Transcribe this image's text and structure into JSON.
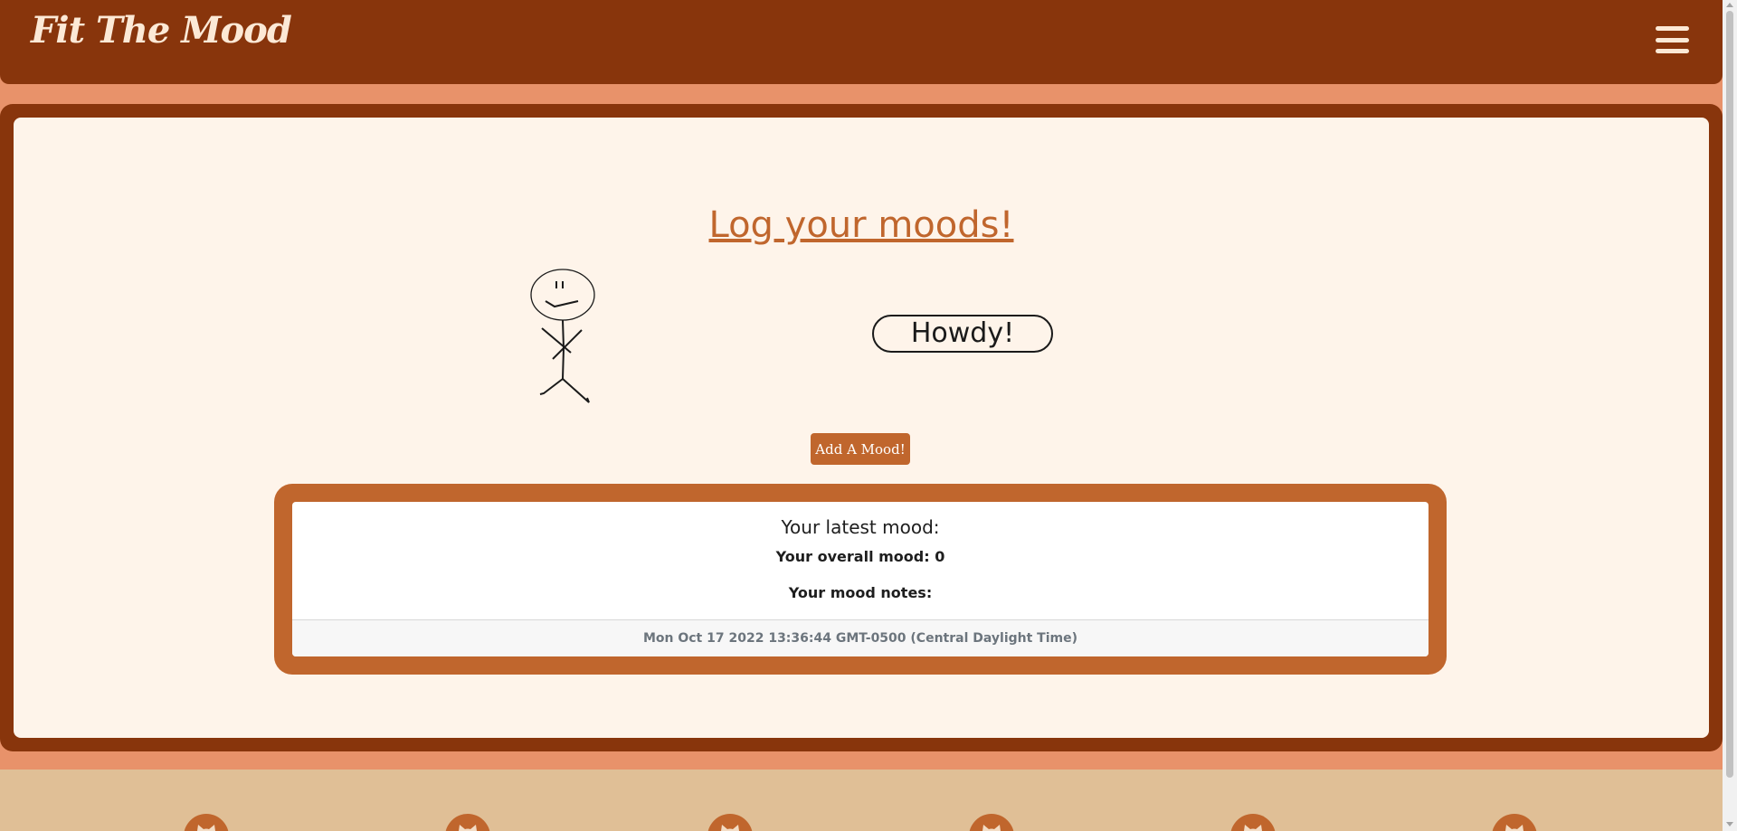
{
  "app": {
    "brand": "Fit The Mood",
    "menu_icon": "hamburger-menu-icon",
    "colors": {
      "header": "#88350C",
      "accent": "#C0662D",
      "panel": "#FEF4EA",
      "page": "#E8926A",
      "footer": "#E0BF96"
    }
  },
  "main": {
    "title": "Log your moods!",
    "speech": "Howdy!",
    "add_button": "Add A Mood!"
  },
  "mood_card": {
    "title": "Your latest mood:",
    "overall_label": "Your overall mood:",
    "overall_value": "0",
    "notes_label": "Your mood notes:",
    "timestamp": "Mon Oct 17 2022 13:36:44 GMT-0500 (Central Daylight Time)"
  },
  "footer": {
    "icons": [
      "github-icon",
      "github-icon",
      "github-icon",
      "github-icon",
      "github-icon",
      "github-icon"
    ]
  }
}
